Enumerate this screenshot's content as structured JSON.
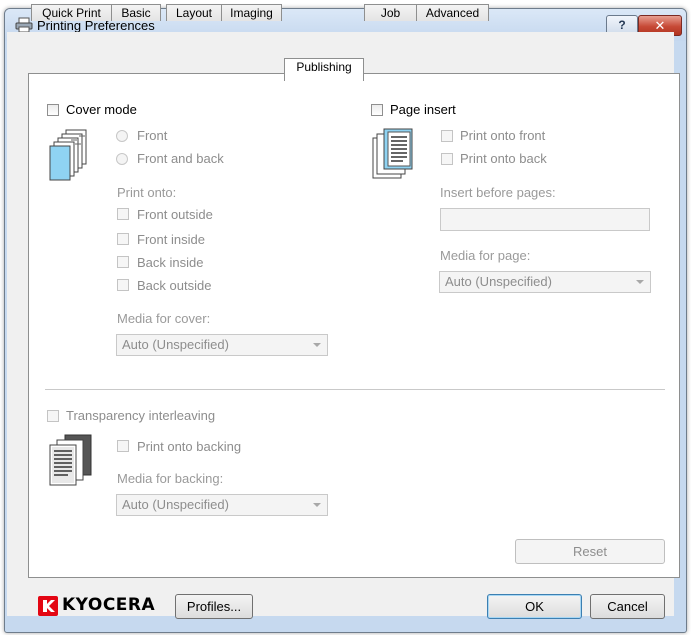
{
  "window": {
    "title": "Printing Preferences",
    "help_label": "?",
    "close_label": "✕"
  },
  "tabs": [
    {
      "label": "Quick Print",
      "active": false
    },
    {
      "label": "Basic",
      "active": false
    },
    {
      "label": "Layout",
      "active": false
    },
    {
      "label": "Imaging",
      "active": false
    },
    {
      "label": "Publishing",
      "active": true
    },
    {
      "label": "Job",
      "active": false
    },
    {
      "label": "Advanced",
      "active": false
    }
  ],
  "cover": {
    "mode_label": "Cover mode",
    "mode_checked": false,
    "front_label": "Front",
    "front_and_back_label": "Front and back",
    "print_onto_label": "Print onto:",
    "front_outside_label": "Front outside",
    "front_inside_label": "Front inside",
    "back_inside_label": "Back inside",
    "back_outside_label": "Back outside",
    "media_label": "Media for cover:",
    "media_value": "Auto (Unspecified)"
  },
  "page_insert": {
    "label": "Page insert",
    "checked": false,
    "print_front_label": "Print onto front",
    "print_back_label": "Print onto back",
    "insert_before_label": "Insert before pages:",
    "insert_before_value": "",
    "media_label": "Media for page:",
    "media_value": "Auto (Unspecified)"
  },
  "transparency": {
    "label": "Transparency interleaving",
    "print_backing_label": "Print onto backing",
    "media_label": "Media for backing:",
    "media_value": "Auto (Unspecified)"
  },
  "buttons": {
    "reset": "Reset",
    "profiles": "Profiles...",
    "ok": "OK",
    "cancel": "Cancel"
  },
  "brand": {
    "name": "KYOCERA",
    "color": "#e30613"
  }
}
